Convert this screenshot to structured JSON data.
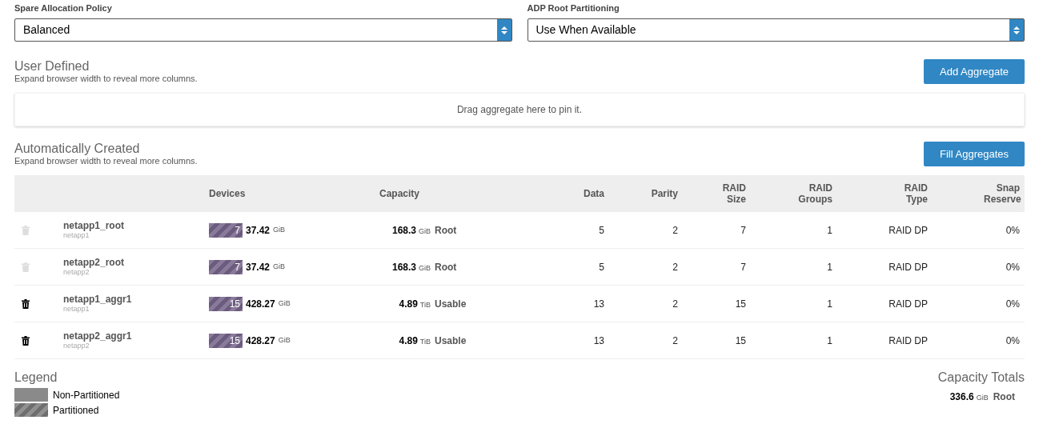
{
  "selects": [
    {
      "label": "Spare Allocation Policy",
      "value": "Balanced"
    },
    {
      "label": "ADP Root Partitioning",
      "value": "Use When Available"
    }
  ],
  "user_defined": {
    "title": "User Defined",
    "hint": "Expand browser width to reveal more columns.",
    "button": "Add Aggregate",
    "dropzone": "Drag aggregate here to pin it."
  },
  "auto_created": {
    "title": "Automatically Created",
    "hint": "Expand browser width to reveal more columns.",
    "button": "Fill Aggregates"
  },
  "table": {
    "columns": [
      {
        "label": "Devices"
      },
      {
        "label": "Capacity"
      },
      {
        "label": "Data"
      },
      {
        "label": "Parity"
      },
      {
        "label": "RAID Size"
      },
      {
        "label": "RAID Groups"
      },
      {
        "label": "RAID Type"
      },
      {
        "label": "Snap Reserve"
      }
    ],
    "rows": [
      {
        "deletable": false,
        "name": "netapp1_root",
        "node": "netapp1",
        "device_count": "7",
        "partitioned": true,
        "device_size": "37.42",
        "device_unit": "GiB",
        "capacity": "168.3",
        "capacity_unit": "GiB",
        "capacity_kind": "Root",
        "data": "5",
        "parity": "2",
        "raid_size": "7",
        "raid_groups": "1",
        "raid_type": "RAID DP",
        "snap_reserve": "0%"
      },
      {
        "deletable": false,
        "name": "netapp2_root",
        "node": "netapp2",
        "device_count": "7",
        "partitioned": true,
        "device_size": "37.42",
        "device_unit": "GiB",
        "capacity": "168.3",
        "capacity_unit": "GiB",
        "capacity_kind": "Root",
        "data": "5",
        "parity": "2",
        "raid_size": "7",
        "raid_groups": "1",
        "raid_type": "RAID DP",
        "snap_reserve": "0%"
      },
      {
        "deletable": true,
        "name": "netapp1_aggr1",
        "node": "netapp1",
        "device_count": "15",
        "partitioned": true,
        "device_size": "428.27",
        "device_unit": "GiB",
        "capacity": "4.89",
        "capacity_unit": "TiB",
        "capacity_kind": "Usable",
        "data": "13",
        "parity": "2",
        "raid_size": "15",
        "raid_groups": "1",
        "raid_type": "RAID DP",
        "snap_reserve": "0%"
      },
      {
        "deletable": true,
        "name": "netapp2_aggr1",
        "node": "netapp2",
        "device_count": "15",
        "partitioned": true,
        "device_size": "428.27",
        "device_unit": "GiB",
        "capacity": "4.89",
        "capacity_unit": "TiB",
        "capacity_kind": "Usable",
        "data": "13",
        "parity": "2",
        "raid_size": "15",
        "raid_groups": "1",
        "raid_type": "RAID DP",
        "snap_reserve": "0%"
      }
    ]
  },
  "legend": {
    "title": "Legend",
    "items": [
      {
        "label": "Non-Partitioned",
        "partitioned": false
      },
      {
        "label": "Partitioned",
        "partitioned": true
      }
    ]
  },
  "totals": {
    "title": "Capacity Totals",
    "items": [
      {
        "value": "336.6",
        "unit": "GiB",
        "kind": "Root"
      }
    ]
  }
}
